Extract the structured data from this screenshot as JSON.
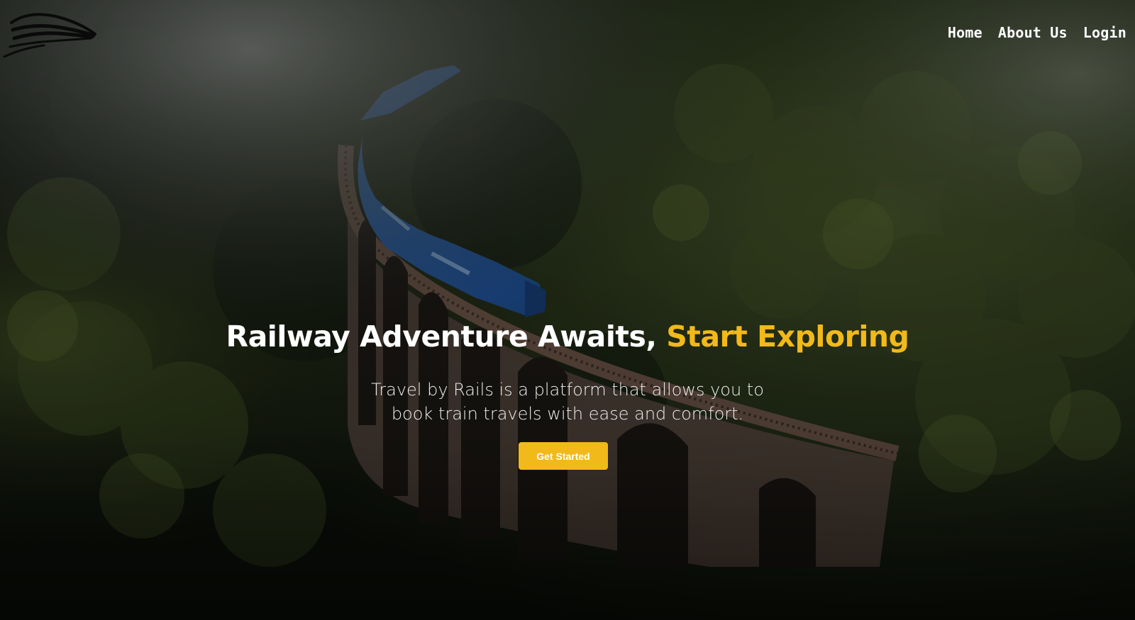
{
  "nav": {
    "items": [
      {
        "label": "Home"
      },
      {
        "label": "About Us"
      },
      {
        "label": "Login"
      }
    ]
  },
  "hero": {
    "title_main": "Railway Adventure Awaits, ",
    "title_accent": "Start Exploring",
    "subtitle_line1": "Travel by Rails is a platform that allows you to",
    "subtitle_line2": "book train travels with ease and comfort.",
    "cta_label": "Get Started"
  },
  "colors": {
    "accent": "#f2b91a",
    "text": "#ffffff",
    "forest": "#1f2a17",
    "train": "#2a63b0"
  },
  "icons": {
    "logo": "train-logo-icon"
  }
}
